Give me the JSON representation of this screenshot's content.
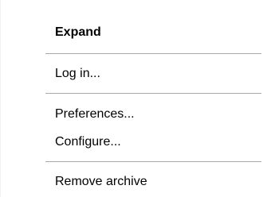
{
  "menu": {
    "items": [
      {
        "label": "Expand"
      },
      {
        "label": "Log in..."
      },
      {
        "label": "Preferences..."
      },
      {
        "label": "Configure..."
      },
      {
        "label": "Remove archive"
      }
    ]
  }
}
